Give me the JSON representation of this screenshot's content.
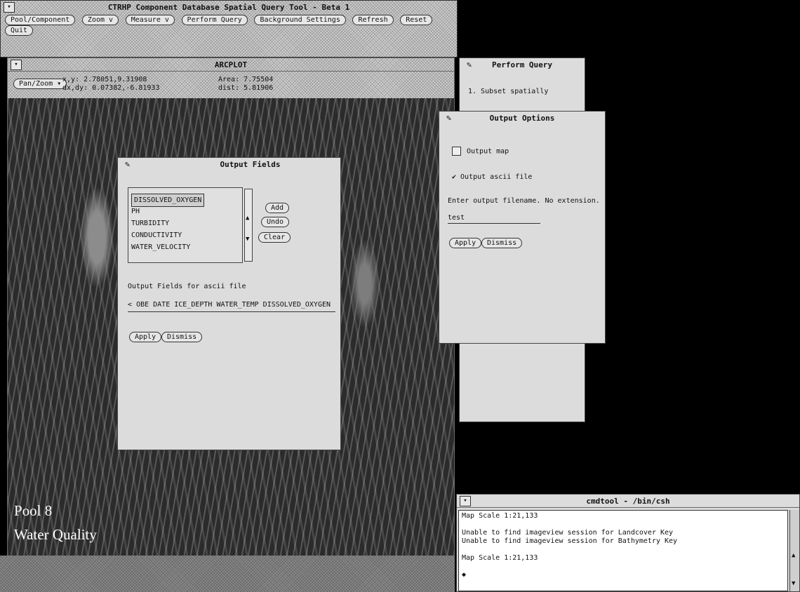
{
  "main_window": {
    "title": "CTRHP Component Database Spatial Query Tool - Beta 1",
    "menu": [
      "Pool/Component",
      "Zoom",
      "Measure",
      "Perform Query",
      "Background Settings",
      "Refresh",
      "Reset",
      "Quit"
    ],
    "menu_arrows": [
      "",
      "v",
      "v",
      "",
      "",
      "",
      "",
      ""
    ]
  },
  "arcplot": {
    "title": "ARCPLOT",
    "pan_zoom_label": "Pan/Zoom",
    "xy": "x,y: 2.78051,9.31908",
    "dxdy": "dx,dy: 0.07382,-6.81933",
    "area": "Area: 7.75504",
    "dist": "dist: 5.81906",
    "overlay_line1": "Pool 8",
    "overlay_line2": "Water Quality"
  },
  "output_fields": {
    "title": "Output Fields",
    "items": [
      "DISSOLVED_OXYGEN",
      "PH",
      "TURBIDITY",
      "CONDUCTIVITY",
      "WATER_VELOCITY"
    ],
    "selected_index": 0,
    "buttons": {
      "add": "Add",
      "undo": "Undo",
      "clear": "Clear"
    },
    "ascii_label": "Output Fields for ascii file",
    "ascii_value": "OBE DATE ICE_DEPTH WATER_TEMP DISSOLVED_OXYGEN",
    "apply": "Apply",
    "dismiss": "Dismiss"
  },
  "perform_query": {
    "title": "Perform Query",
    "step": "1. Subset spatially"
  },
  "output_options": {
    "title": "Output Options",
    "output_map": "Output map",
    "output_ascii": "Output ascii file",
    "checkmark": "✔",
    "filename_prompt": "Enter output filename. No extension.",
    "filename_value": "test",
    "apply": "Apply",
    "dismiss": "Dismiss"
  },
  "cmdtool": {
    "title": "cmdtool - /bin/csh",
    "lines": [
      "Map Scale 1:21,133",
      "",
      "Unable to find imageview session for Landcover Key",
      "Unable to find imageview session for Bathymetry Key",
      "",
      "Map Scale 1:21,133",
      "",
      "◆"
    ]
  }
}
